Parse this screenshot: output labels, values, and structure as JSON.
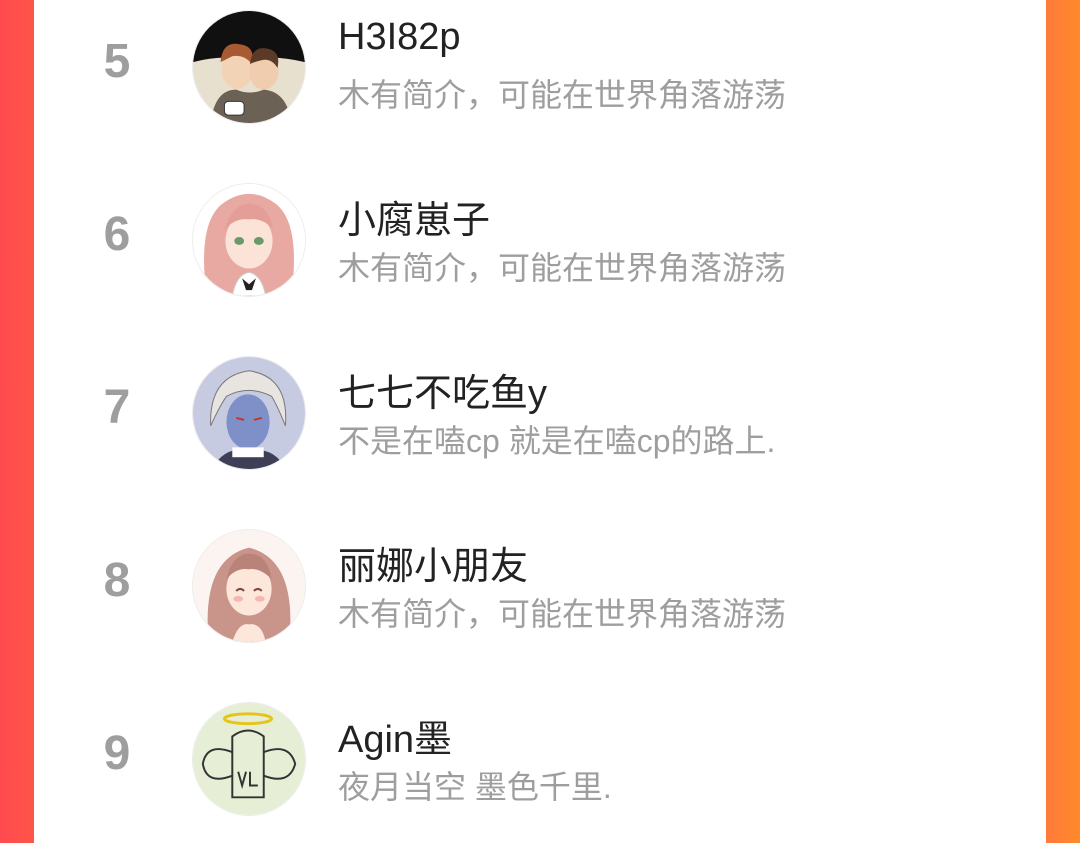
{
  "ranking": {
    "items": [
      {
        "rank": "5",
        "name": "H3I82p",
        "bio": "木有简介，可能在世界角落游荡",
        "avatar_icon": "avatar-two-boys-icon"
      },
      {
        "rank": "6",
        "name": "小腐崽子",
        "bio": "木有简介，可能在世界角落游荡",
        "avatar_icon": "avatar-pink-hair-girl-icon"
      },
      {
        "rank": "7",
        "name": "七七不吃鱼y",
        "bio": "不是在嗑cp 就是在嗑cp的路上.",
        "avatar_icon": "avatar-blue-skin-character-icon"
      },
      {
        "rank": "8",
        "name": "丽娜小朋友",
        "bio": "木有简介，可能在世界角落游荡",
        "avatar_icon": "avatar-brown-hair-girl-icon"
      },
      {
        "rank": "9",
        "name": "Agin墨",
        "bio": "夜月当空 墨色千里.",
        "avatar_icon": "avatar-angel-doodle-icon"
      }
    ]
  },
  "colors": {
    "rank_gray": "#9e9e9e",
    "name_black": "#222222",
    "bio_gray": "#9e9e9e",
    "border_left": "#ff4a4f",
    "border_right": "#ff7a3a"
  }
}
